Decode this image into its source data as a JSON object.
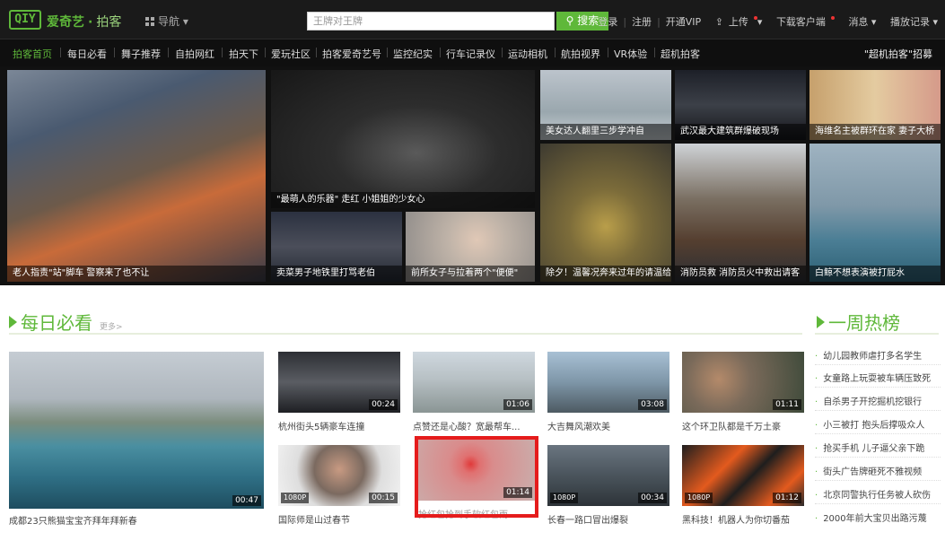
{
  "brand": {
    "logo": "QIY",
    "name": "爱奇艺",
    "sep": "·",
    "section": "拍客"
  },
  "header": {
    "nav_label": "导航",
    "search_placeholder": "王牌对王牌",
    "search_button": "搜索",
    "links": [
      "登录",
      "注册",
      "开通VIP",
      "上传",
      "下载客户端",
      "消息",
      "播放记录"
    ]
  },
  "subnav": {
    "items": [
      "拍客首页",
      "每日必看",
      "舞子推荐",
      "自拍网红",
      "拍天下",
      "爱玩社区",
      "拍客爱奇艺号",
      "监控纪实",
      "行车记录仪",
      "运动相机",
      "航拍视界",
      "VR体验",
      "超机拍客"
    ],
    "right_link": "\"超机拍客\"招募"
  },
  "hero": {
    "captions": [
      "老人指责\"站\"脚车 警察来了也不让",
      "\"最萌人的乐器\" 走红 小姐姐的少女心",
      "卖菜男子地铁里打骂老伯",
      "前所女子与拉着两个\"便便\"",
      "美女达人翻里三步学冲自",
      "武汉最大建筑群爆破现场",
      "海维名主被群环在家 妻子大桥",
      "除夕！温馨况奔来过年的请温给路",
      "消防员救 消防员火中救出请客",
      "白鲸不想表演被打屁水"
    ]
  },
  "daily": {
    "title": "每日必看",
    "more": "更多>",
    "main_title": "成都23只熊猫宝宝齐拜年拜新春",
    "main_duration": "00:47",
    "videos": [
      {
        "title": "杭州街头5辆豪车连撞",
        "duration": "00:24",
        "hd": ""
      },
      {
        "title": "点赞还是心酸？宽最帮车...",
        "duration": "01:06",
        "hd": ""
      },
      {
        "title": "大吉舞风潮欢美",
        "duration": "03:08",
        "hd": ""
      },
      {
        "title": "这个环卫队都是千万土豪",
        "duration": "01:11",
        "hd": ""
      },
      {
        "title": "国际师是山过春节",
        "duration": "00:15",
        "hd": "1080P"
      },
      {
        "title": "抢红包抢到手软红包雨",
        "duration": "01:14",
        "hd": ""
      },
      {
        "title": "长春一路口冒出爆裂",
        "duration": "00:34",
        "hd": "1080P"
      },
      {
        "title": "黑科技！机器人为你切番茄",
        "duration": "01:12",
        "hd": "1080P"
      }
    ]
  },
  "weekly": {
    "title": "一周热榜",
    "items": [
      "幼儿园教师虐打多名学生",
      "女童路上玩耍被车辆压致死",
      "自杀男子开挖掘机挖银行",
      "小三被打 抱头后撑吸众人",
      "抢买手机 儿子逼父亲下跪",
      "街头广告牌砸死不雅视频",
      "北京同警执行任务被人砍伤",
      "2000年前大宝贝出路污蔑"
    ]
  },
  "colors": {
    "accent": "#5fb83a",
    "topbar": "#1a1a1a",
    "highlight": "#e51c1c"
  }
}
